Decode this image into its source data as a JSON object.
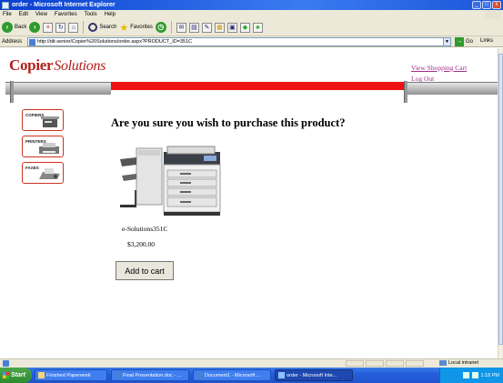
{
  "window": {
    "title": "order - Microsoft Internet Explorer",
    "controls": [
      "_",
      "□",
      "x"
    ]
  },
  "menu": [
    "File",
    "Edit",
    "View",
    "Favorites",
    "Tools",
    "Help"
  ],
  "toolbar": {
    "back_label": "Back",
    "search_label": "Search",
    "favorites_label": "Favorites"
  },
  "address": {
    "label": "Address",
    "url": "http://dit-senior/Copier%20Solutions/order.aspx?PRODUCT_ID=351C",
    "go_label": "Go",
    "links_label": "Links"
  },
  "page": {
    "logo_main": "Copier",
    "logo_sub": "Solutions",
    "links": {
      "shopping_cart": "View Shopping Cart",
      "log_out": "Log Out"
    },
    "side_nav": [
      {
        "label": "COPIERS"
      },
      {
        "label": "PRINTERS"
      },
      {
        "label": "FAXES"
      }
    ],
    "question": "Are you sure you wish to purchase this product?",
    "product": {
      "name": "e-Solutions351C",
      "price": "$3,200.00"
    },
    "add_to_cart_label": "Add to cart",
    "colors": {
      "brand_red": "#b2201c",
      "bar_red": "#ee1111",
      "link_purple": "#a0308a"
    }
  },
  "statusbar": {
    "zone": "Local intranet"
  },
  "taskbar": {
    "start_label": "Start",
    "tasks": [
      {
        "label": "Finished Paperwork"
      },
      {
        "label": "Final Presentation.doc - ..."
      },
      {
        "label": "Document1 - Microsoft ..."
      },
      {
        "label": "order - Microsoft Inte..."
      }
    ],
    "clock": "1:18 PM"
  }
}
